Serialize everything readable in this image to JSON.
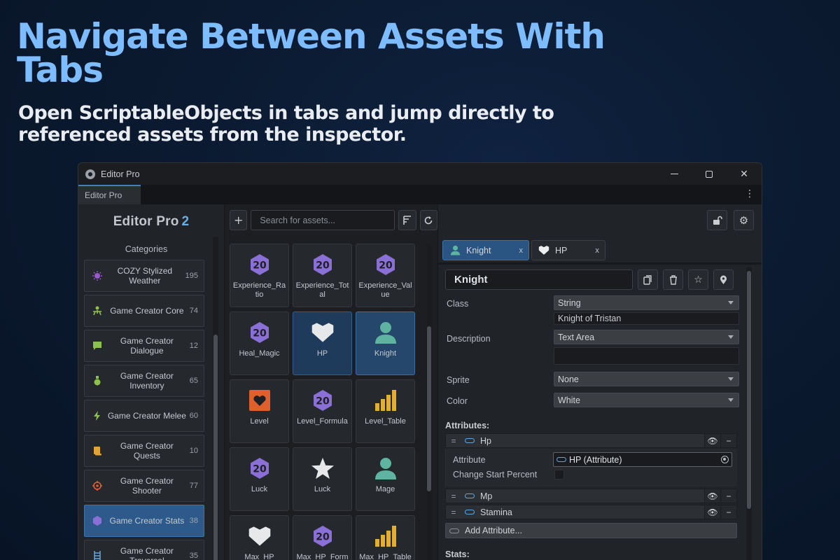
{
  "hero": {
    "title": "Navigate Between Assets With Tabs",
    "subtitle": "Open ScriptableObjects in tabs and jump directly to referenced assets from the inspector."
  },
  "window": {
    "title": "Editor Pro",
    "tab_label": "Editor Pro"
  },
  "sidebar": {
    "brand": "Editor Pro",
    "brand_version": "2",
    "categories_label": "Categories",
    "items": [
      {
        "label": "COZY Stylized Weather",
        "count": "195",
        "icon": "sun-icon",
        "color": "#9b59d0"
      },
      {
        "label": "Game Creator Core",
        "count": "74",
        "icon": "person-icon",
        "color": "#8bc34a"
      },
      {
        "label": "Game Creator Dialogue",
        "count": "12",
        "icon": "chat-icon",
        "color": "#8bc34a"
      },
      {
        "label": "Game Creator Inventory",
        "count": "65",
        "icon": "potion-icon",
        "color": "#8bc34a"
      },
      {
        "label": "Game Creator Melee",
        "count": "60",
        "icon": "lightning-icon",
        "color": "#8bc34a"
      },
      {
        "label": "Game Creator Quests",
        "count": "10",
        "icon": "scroll-icon",
        "color": "#e0a532"
      },
      {
        "label": "Game Creator Shooter",
        "count": "77",
        "icon": "crosshair-icon",
        "color": "#e0602d"
      },
      {
        "label": "Game Creator Stats",
        "count": "38",
        "icon": "stats-icon",
        "color": "#8a6fd6",
        "active": true
      },
      {
        "label": "Game Creator Traversal",
        "count": "35",
        "icon": "ladder-icon",
        "color": "#5ea7e0"
      }
    ]
  },
  "assets": {
    "search_placeholder": "Search for assets...",
    "items": [
      {
        "label": "Experience_Ratio",
        "icon": "d20-icon"
      },
      {
        "label": "Experience_Total",
        "icon": "d20-icon"
      },
      {
        "label": "Experience_Value",
        "icon": "d20-icon"
      },
      {
        "label": "Heal_Magic",
        "icon": "d20-icon"
      },
      {
        "label": "HP",
        "icon": "heart-icon",
        "state": "selected2"
      },
      {
        "label": "Knight",
        "icon": "person-icon",
        "state": "selected"
      },
      {
        "label": "Level",
        "icon": "heart-box-icon"
      },
      {
        "label": "Level_Formula",
        "icon": "d20-icon"
      },
      {
        "label": "Level_Table",
        "icon": "bars-icon"
      },
      {
        "label": "Luck",
        "icon": "d20-icon"
      },
      {
        "label": "Luck",
        "icon": "star-icon"
      },
      {
        "label": "Mage",
        "icon": "person-icon"
      },
      {
        "label": "Max_HP",
        "icon": "heart-icon"
      },
      {
        "label": "Max_HP_Formula",
        "icon": "d20-icon"
      },
      {
        "label": "Max_HP_Table",
        "icon": "bars-icon"
      }
    ]
  },
  "inspector": {
    "tabs": [
      {
        "label": "Knight",
        "icon": "person-icon",
        "close": "x",
        "active": true
      },
      {
        "label": "HP",
        "icon": "heart-icon",
        "close": "x",
        "active": false
      }
    ],
    "name": "Knight",
    "class_label": "Class",
    "class_value": "String",
    "class_text": "Knight of Tristan",
    "description_label": "Description",
    "description_value": "Text Area",
    "description_text": "",
    "sprite_label": "Sprite",
    "sprite_value": "None",
    "color_label": "Color",
    "color_value": "White",
    "attributes_label": "Attributes:",
    "attributes": [
      {
        "name": "Hp"
      },
      {
        "name": "Mp"
      },
      {
        "name": "Stamina"
      }
    ],
    "attr_field_label": "Attribute",
    "attr_field_value": "HP (Attribute)",
    "change_start_label": "Change Start Percent",
    "add_attribute_label": "Add Attribute...",
    "stats_label": "Stats:"
  },
  "colors": {
    "accent": "#7cbcff",
    "selection": "#2d5a8a",
    "d20": "#8a6fd6",
    "person": "#5fb3a1",
    "heart_box": "#e0602d",
    "bars": "#e0b032"
  }
}
